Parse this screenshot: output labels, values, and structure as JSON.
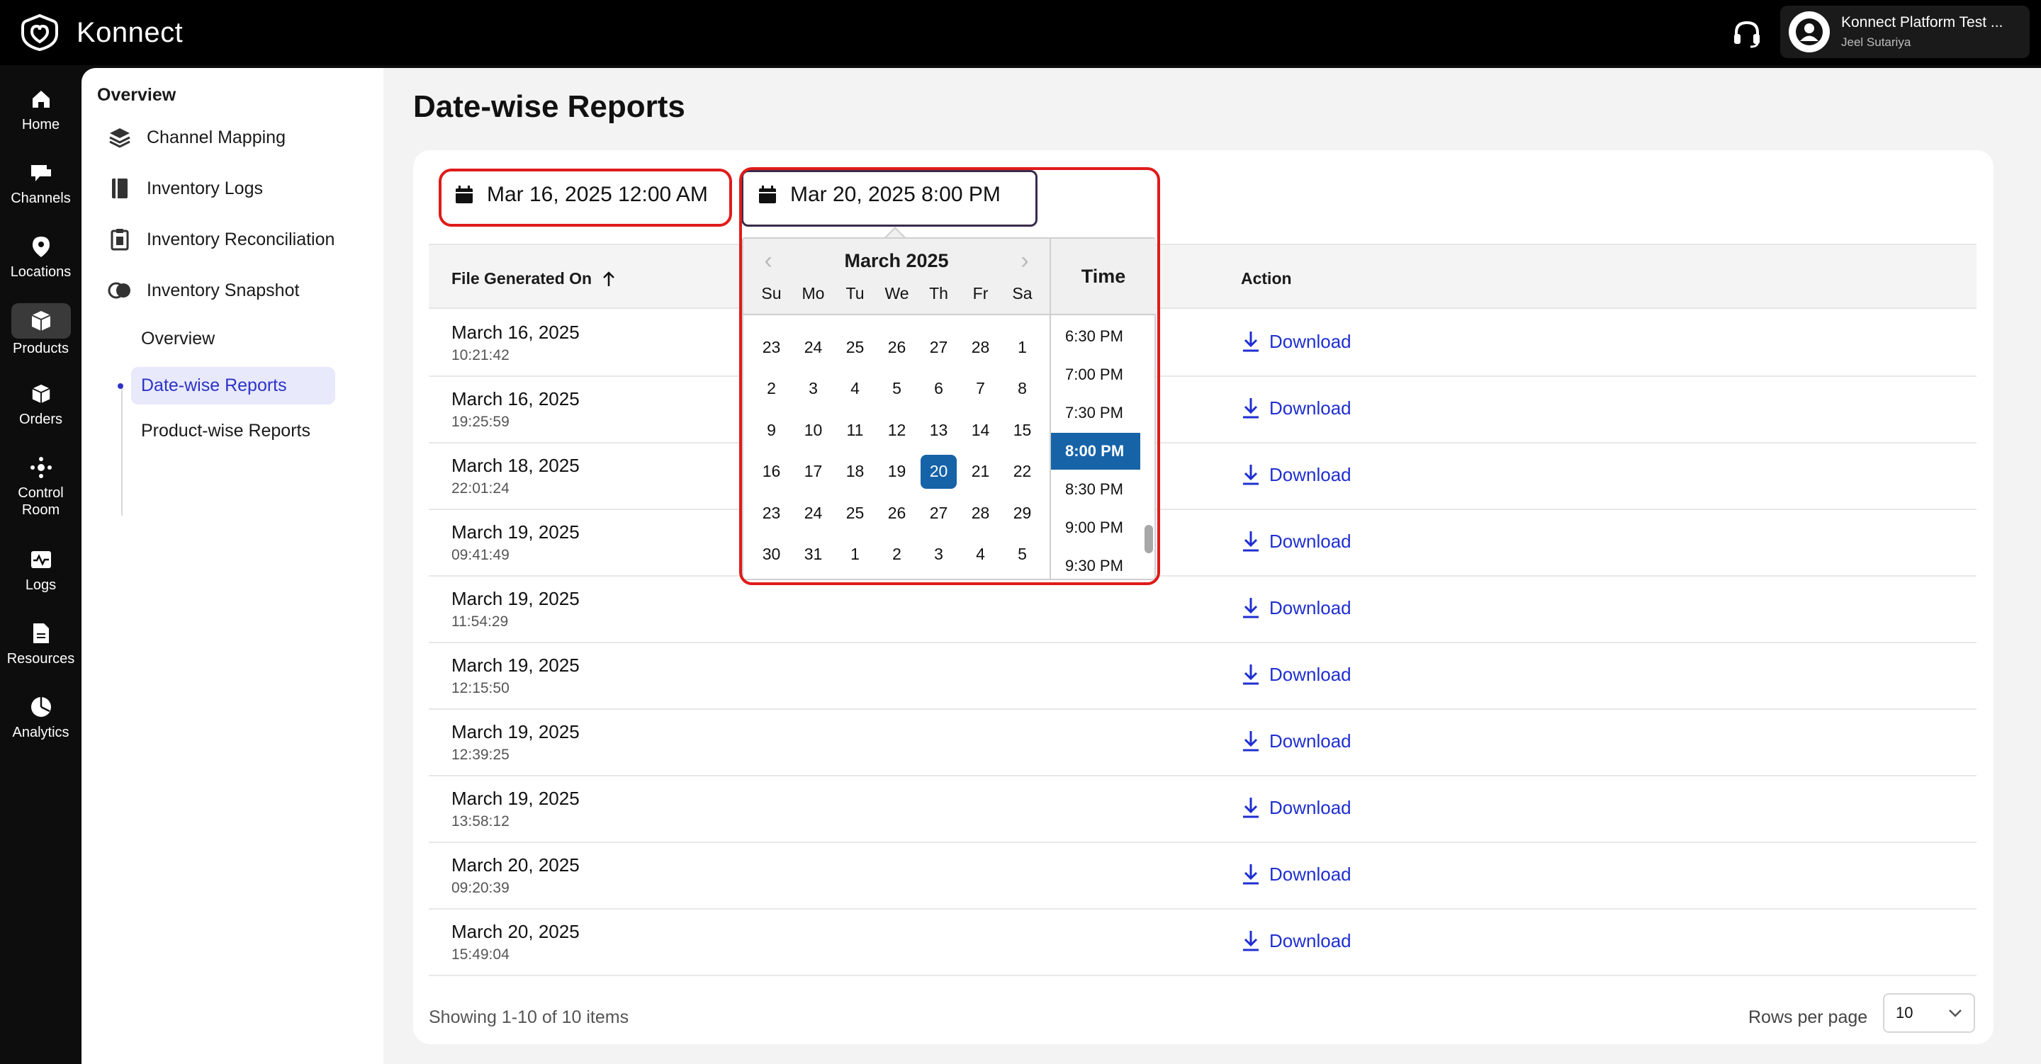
{
  "app": {
    "brand": "Konnect"
  },
  "user": {
    "org": "Konnect Platform Test ...",
    "name": "Jeel Sutariya"
  },
  "rail": [
    {
      "label": "Home"
    },
    {
      "label": "Channels"
    },
    {
      "label": "Locations"
    },
    {
      "label": "Products"
    },
    {
      "label": "Orders"
    },
    {
      "label": "Control Room"
    },
    {
      "label": "Logs"
    },
    {
      "label": "Resources"
    },
    {
      "label": "Analytics"
    }
  ],
  "subnav": {
    "section": "Overview",
    "items": [
      "Channel Mapping",
      "Inventory Logs",
      "Inventory Reconciliation",
      "Inventory Snapshot"
    ],
    "children": [
      "Overview",
      "Date-wise Reports",
      "Product-wise Reports"
    ]
  },
  "page": {
    "title": "Date-wise Reports"
  },
  "filters": {
    "start": "Mar 16, 2025 12:00 AM",
    "end": "Mar 20, 2025 8:00 PM"
  },
  "picker": {
    "month": "March 2025",
    "dows": [
      "Su",
      "Mo",
      "Tu",
      "We",
      "Th",
      "Fr",
      "Sa"
    ],
    "days": [
      "23",
      "24",
      "25",
      "26",
      "27",
      "28",
      "1",
      "2",
      "3",
      "4",
      "5",
      "6",
      "7",
      "8",
      "9",
      "10",
      "11",
      "12",
      "13",
      "14",
      "15",
      "16",
      "17",
      "18",
      "19",
      "20",
      "21",
      "22",
      "23",
      "24",
      "25",
      "26",
      "27",
      "28",
      "29",
      "30",
      "31",
      "1",
      "2",
      "3",
      "4",
      "5"
    ],
    "selected_day": "20",
    "time_header": "Time",
    "times": [
      "6:30 PM",
      "7:00 PM",
      "7:30 PM",
      "8:00 PM",
      "8:30 PM",
      "9:00 PM",
      "9:30 PM"
    ],
    "selected_time": "8:00 PM"
  },
  "table": {
    "col_date": "File Generated On",
    "col_action": "Action",
    "action_label": "Download",
    "rows": [
      {
        "date": "March 16, 2025",
        "time": "10:21:42"
      },
      {
        "date": "March 16, 2025",
        "time": "19:25:59"
      },
      {
        "date": "March 18, 2025",
        "time": "22:01:24"
      },
      {
        "date": "March 19, 2025",
        "time": "09:41:49"
      },
      {
        "date": "March 19, 2025",
        "time": "11:54:29"
      },
      {
        "date": "March 19, 2025",
        "time": "12:15:50"
      },
      {
        "date": "March 19, 2025",
        "time": "12:39:25"
      },
      {
        "date": "March 19, 2025",
        "time": "13:58:12"
      },
      {
        "date": "March 20, 2025",
        "time": "09:20:39"
      },
      {
        "date": "March 20, 2025",
        "time": "15:49:04"
      }
    ]
  },
  "footer": {
    "showing": "Showing 1-10 of 10 items",
    "rpp_label": "Rows per page",
    "rpp_value": "10"
  },
  "colors": {
    "accent": "#2d33c7",
    "link": "#1f2fd1",
    "selected": "#1663a8",
    "highlight": "#e01b1b"
  }
}
